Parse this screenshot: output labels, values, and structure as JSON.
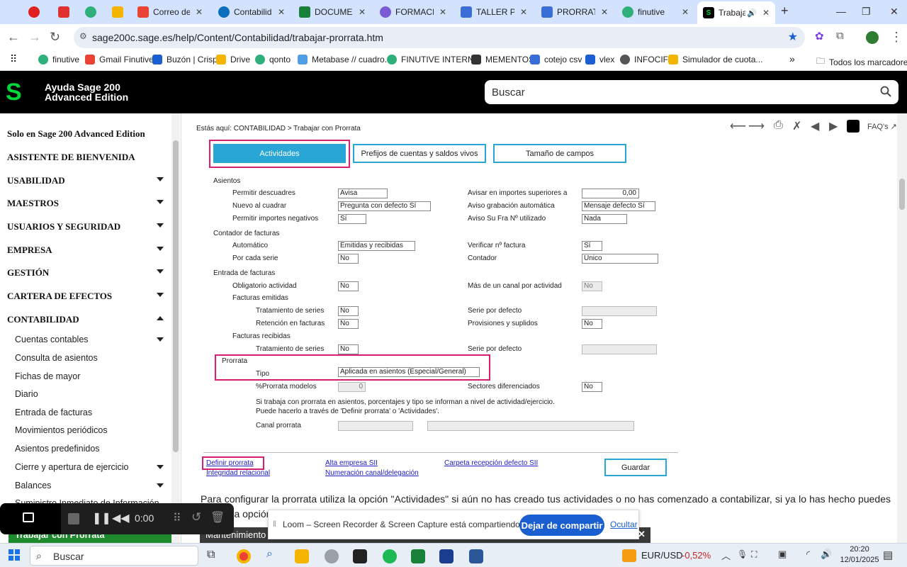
{
  "browser": {
    "tabs": [
      {
        "label": "",
        "color": "#e02020"
      },
      {
        "label": "",
        "color": "#e03030"
      },
      {
        "label": "",
        "color": "#2fb07a"
      },
      {
        "label": "",
        "color": "#f4b400"
      },
      {
        "label": "Correo de Fi",
        "color": "#ea4335"
      },
      {
        "label": "Contabilidad",
        "color": "#0a6ebd"
      },
      {
        "label": "DOCUMENT",
        "color": "#188038"
      },
      {
        "label": "FORMACIÓN",
        "color": "#7c5cd6"
      },
      {
        "label": "TALLER PRO",
        "color": "#3b6dd6"
      },
      {
        "label": "PRORRATA",
        "color": "#3b6dd6"
      },
      {
        "label": "finutive",
        "color": "#2fb07a"
      },
      {
        "label": "Trabajar",
        "color": "#000000",
        "active": true
      }
    ],
    "url": "sage200c.sage.es/help/Content/Contabilidad/trabajar-prorrata.htm",
    "bookmarks": [
      {
        "label": "finutive",
        "color": "#2fb07a"
      },
      {
        "label": "Gmail Finutive",
        "color": "#ea4335"
      },
      {
        "label": "Buzón | Crisp",
        "color": "#1a5fd1"
      },
      {
        "label": "Drive",
        "color": "#f4b400"
      },
      {
        "label": "qonto",
        "color": "#2fb07a"
      },
      {
        "label": "Metabase // cuadro...",
        "color": "#509ee3"
      },
      {
        "label": "FINUTIVE INTERNO",
        "color": "#2fb07a"
      },
      {
        "label": "MEMENTOS",
        "color": "#333333"
      },
      {
        "label": "cotejo csv",
        "color": "#3b6dd6"
      },
      {
        "label": "vlex",
        "color": "#1a5fd1"
      },
      {
        "label": "INFOCIF",
        "color": "#555555"
      },
      {
        "label": "Simulador de cuota...",
        "color": "#f4b400"
      }
    ],
    "all_bookmarks": "Todos los marcadores"
  },
  "header": {
    "logo": "S",
    "title": "Ayuda Sage 200 Advanced Edition",
    "search_placeholder": "Buscar"
  },
  "sidebar": {
    "items": [
      {
        "label": "Solo en Sage 200 Advanced Edition",
        "level": 1
      },
      {
        "label": "ASISTENTE DE BIENVENIDA",
        "level": 1
      },
      {
        "label": "USABILIDAD",
        "level": 1,
        "caret": "down"
      },
      {
        "label": "MAESTROS",
        "level": 1,
        "caret": "down"
      },
      {
        "label": "USUARIOS Y SEGURIDAD",
        "level": 1,
        "caret": "down"
      },
      {
        "label": "EMPRESA",
        "level": 1,
        "caret": "down"
      },
      {
        "label": "GESTIÓN",
        "level": 1,
        "caret": "down"
      },
      {
        "label": "CARTERA DE EFECTOS",
        "level": 1,
        "caret": "down"
      },
      {
        "label": "CONTABILIDAD",
        "level": 1,
        "caret": "up"
      },
      {
        "label": "Cuentas contables",
        "level": 2,
        "caret": "down"
      },
      {
        "label": "Consulta de asientos",
        "level": 2
      },
      {
        "label": "Fichas de mayor",
        "level": 2
      },
      {
        "label": "Diario",
        "level": 2
      },
      {
        "label": "Entrada de facturas",
        "level": 2
      },
      {
        "label": "Movimientos periódicos",
        "level": 2
      },
      {
        "label": "Asientos predefinidos",
        "level": 2
      },
      {
        "label": "Cierre y apertura de ejercicio",
        "level": 2,
        "caret": "down"
      },
      {
        "label": "Balances",
        "level": 2,
        "caret": "down"
      },
      {
        "label": "Suministro Inmediato de Información",
        "level": 2
      }
    ],
    "active": "Trabajar con Prorrata"
  },
  "content": {
    "breadcrumb": "Estás aquí: CONTABILIDAD > Trabajar con Prorrata",
    "faq": "FAQ's",
    "tabs": [
      "Actividades",
      "Prefijos de cuentas y saldos vivos",
      "Tamaño de campos"
    ],
    "sections": {
      "asientos": "Asientos",
      "contador": "Contador de facturas",
      "entrada": "Entrada de facturas",
      "emitidas": "Facturas emitidas",
      "recibidas": "Facturas recibidas",
      "prorrata": "Prorrata"
    },
    "labels": {
      "permitir_descuadres": "Permitir descuadres",
      "nuevo_cuadrar": "Nuevo al cuadrar",
      "permitir_negativos": "Permitir importes negativos",
      "automatico": "Automático",
      "por_serie": "Por cada serie",
      "obligatorio": "Obligatorio actividad",
      "trat_series_e": "Tratamiento de series",
      "retencion": "Retención en facturas",
      "trat_series_r": "Tratamiento de series",
      "tipo": "Tipo",
      "pct_modelos": "%Prorrata modelos",
      "canal": "Canal prorrata",
      "avisar_sup": "Avisar en importes superiores a",
      "aviso_grab": "Aviso grabación automática",
      "aviso_fra": "Aviso Su Fra Nº utilizado",
      "verificar": "Verificar nº factura",
      "contador": "Contador",
      "mas_canal": "Más de un canal por actividad",
      "serie_def_e": "Serie por defecto",
      "provisiones": "Provisiones y suplidos",
      "serie_def_r": "Serie por defecto",
      "sectores": "Sectores diferenciados"
    },
    "values": {
      "permitir_descuadres": "Avisa",
      "nuevo_cuadrar": "Pregunta con defecto Sí",
      "permitir_negativos": "Sí",
      "automatico": "Emitidas y recibidas",
      "por_serie": "No",
      "obligatorio": "No",
      "trat_series_e": "No",
      "retencion": "No",
      "trat_series_r": "No",
      "tipo": "Aplicada en asientos (Especial/General)",
      "pct_modelos": "0",
      "avisar_sup": "0,00",
      "aviso_grab": "Mensaje defecto Sí",
      "aviso_fra": "Nada",
      "verificar": "Sí",
      "contador": "Único",
      "mas_canal": "No",
      "provisiones": "No",
      "sectores": "No"
    },
    "note": "Si trabaja con prorrata en asientos, porcentajes y tipo se informan a nivel de actividad/ejercicio. Puede hacerlo a través de 'Definir prorrata' o 'Actividades'.",
    "links": [
      "Definir prorrata",
      "Integridad relacional",
      "Alta empresa SII",
      "Numeración canal/delegación",
      "Carpeta recepción defecto SII"
    ],
    "save": "Guardar",
    "paragraph": "Para configurar la prorrata utiliza la opción \"Actividades\" si aún no has creado tus actividades o no has comenzado a contabilizar, si ya lo has hecho puedes utilizar la opción \"Definir prorrata\"",
    "bottom_section": "Mantenimiento"
  },
  "loom": {
    "time": "0:00",
    "share_text": "Loom – Screen Recorder & Screen Capture está compartiendo tu pantalla.",
    "stop_button": "Dejar de compartir",
    "hide_link": "Ocultar"
  },
  "taskbar": {
    "search": "Buscar",
    "ticker": "EUR/USD",
    "ticker_change": "-0,52%",
    "time": "20:20",
    "date": "12/01/2025"
  }
}
